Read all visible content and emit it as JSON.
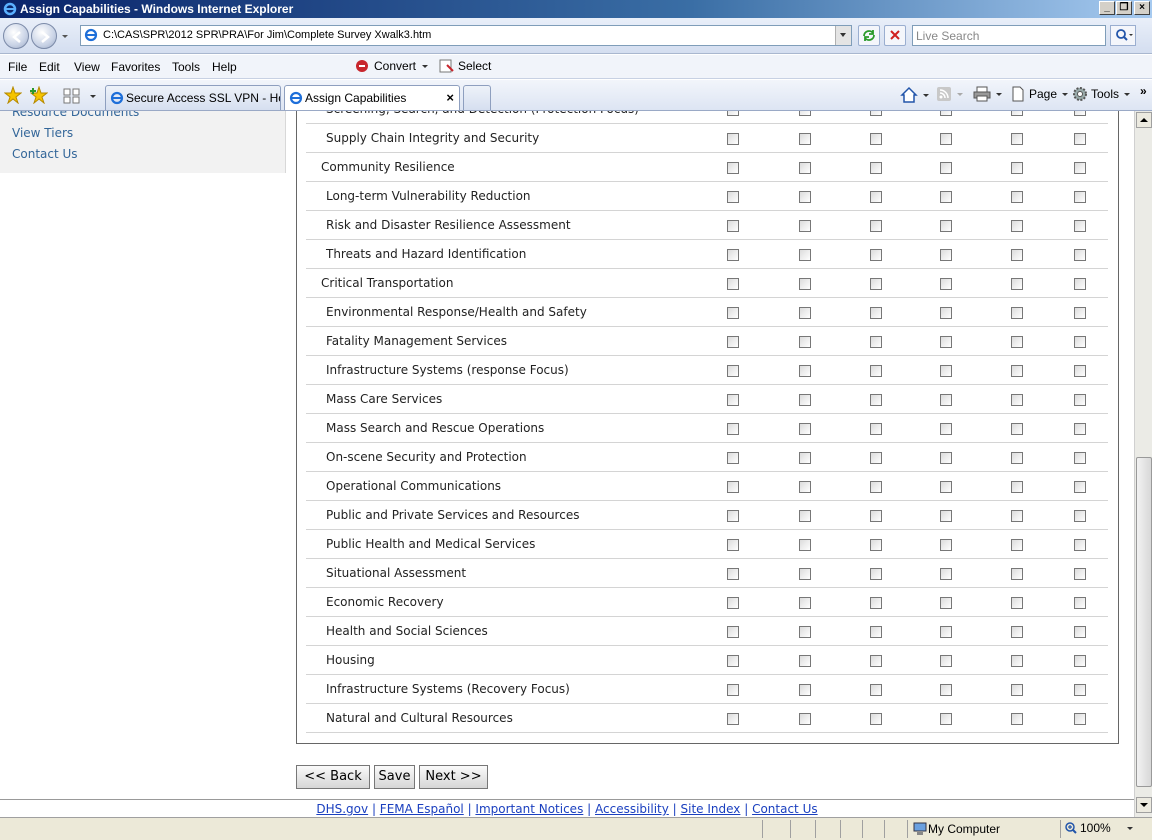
{
  "window": {
    "title": "Assign Capabilities - Windows Internet Explorer"
  },
  "address_bar": {
    "url": "C:\\CAS\\SPR\\2012 SPR\\PRA\\For Jim\\Complete Survey Xwalk3.htm",
    "search_placeholder": "Live Search"
  },
  "menu": {
    "items": [
      "File",
      "Edit",
      "View",
      "Favorites",
      "Tools",
      "Help"
    ],
    "convert_label": "Convert",
    "select_label": "Select"
  },
  "tabs": [
    {
      "label": "Secure Access SSL VPN - Home",
      "active": false
    },
    {
      "label": "Assign Capabilities",
      "active": true
    }
  ],
  "command_bar": {
    "page_label": "Page",
    "tools_label": "Tools"
  },
  "left_nav": {
    "links": [
      "Resource Documents",
      "View Tiers",
      "Contact Us"
    ]
  },
  "survey": {
    "partial_top_row": "Screening, Search, and Detection (Protection Focus)",
    "checkbox_columns": 6,
    "rows": [
      {
        "label": "Supply Chain Integrity and Security",
        "indent": true
      },
      {
        "label": "Community Resilience",
        "indent": false
      },
      {
        "label": "Long-term Vulnerability Reduction",
        "indent": true
      },
      {
        "label": "Risk and Disaster Resilience Assessment",
        "indent": true
      },
      {
        "label": "Threats and Hazard Identification",
        "indent": true
      },
      {
        "label": "Critical Transportation",
        "indent": false
      },
      {
        "label": "Environmental Response/Health and Safety",
        "indent": true
      },
      {
        "label": "Fatality Management Services",
        "indent": true
      },
      {
        "label": "Infrastructure Systems (response Focus)",
        "indent": true
      },
      {
        "label": "Mass Care Services",
        "indent": true
      },
      {
        "label": "Mass Search and Rescue Operations",
        "indent": true
      },
      {
        "label": "On-scene Security and Protection",
        "indent": true
      },
      {
        "label": "Operational Communications",
        "indent": true
      },
      {
        "label": "Public and Private Services and Resources",
        "indent": true
      },
      {
        "label": "Public Health and Medical Services",
        "indent": true
      },
      {
        "label": "Situational Assessment",
        "indent": true
      },
      {
        "label": "Economic Recovery",
        "indent": true
      },
      {
        "label": "Health and Social Sciences",
        "indent": true
      },
      {
        "label": "Housing",
        "indent": true
      },
      {
        "label": "Infrastructure Systems (Recovery Focus)",
        "indent": true
      },
      {
        "label": "Natural and Cultural Resources",
        "indent": true
      }
    ]
  },
  "buttons": {
    "back": "<< Back",
    "save": "Save",
    "next": "Next >>"
  },
  "footer": {
    "links": [
      "DHS.gov",
      "FEMA Español",
      "Important Notices",
      "Accessibility",
      "Site Index",
      "Contact Us"
    ],
    "separator": " | "
  },
  "status_bar": {
    "zone": "My Computer",
    "zoom": "100%"
  },
  "colors": {
    "link": "#336699",
    "footer_link": "#1a3fbf",
    "titlebar": "#0a246a"
  }
}
